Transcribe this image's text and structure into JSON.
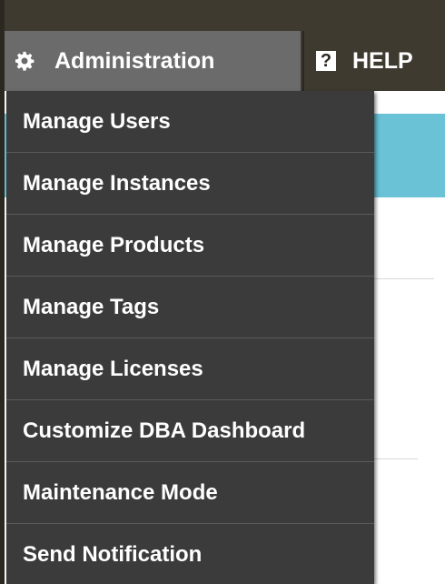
{
  "navbar": {
    "admin_label": "Administration",
    "admin_icon": "gear-icon",
    "help_label": "HELP",
    "help_icon": "question-icon",
    "help_glyph": "?"
  },
  "colors": {
    "navbar_bg": "#3e3a30",
    "active_nav_bg": "#6b6b6b",
    "menu_bg": "#3b3b3b",
    "banner_bg": "#69c2d6"
  },
  "admin_menu": {
    "items": [
      {
        "label": "Manage Users"
      },
      {
        "label": "Manage Instances"
      },
      {
        "label": "Manage Products"
      },
      {
        "label": "Manage Tags"
      },
      {
        "label": "Manage Licenses"
      },
      {
        "label": "Customize DBA Dashboard"
      },
      {
        "label": "Maintenance Mode"
      },
      {
        "label": "Send Notification"
      }
    ]
  }
}
